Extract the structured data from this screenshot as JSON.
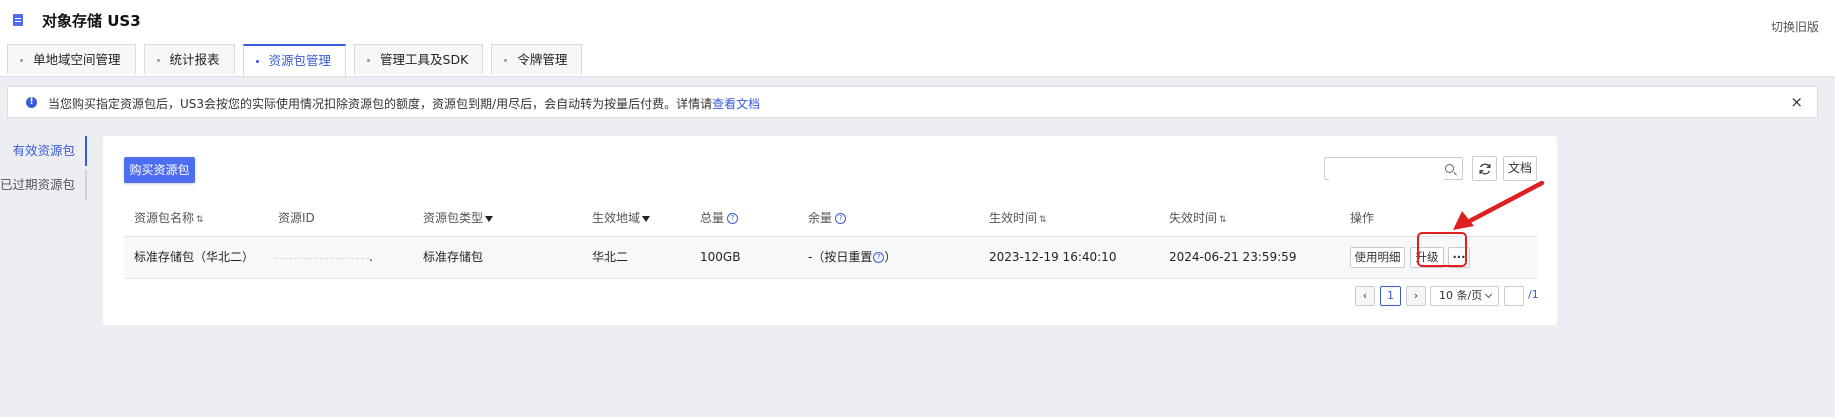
{
  "app": {
    "title": "对象存储 US3",
    "switch_label": "切换旧版"
  },
  "tabs": [
    {
      "label": "单地域空间管理",
      "active": false
    },
    {
      "label": "统计报表",
      "active": false
    },
    {
      "label": "资源包管理",
      "active": true
    },
    {
      "label": "管理工具及SDK",
      "active": false
    },
    {
      "label": "令牌管理",
      "active": false
    }
  ],
  "notice": {
    "text": "当您购买指定资源包后，US3会按您的实际使用情况扣除资源包的额度，资源包到期/用尽后，会自动转为按量后付费。详情请",
    "link": "查看文档",
    "close": "×"
  },
  "side": {
    "items": [
      {
        "label": "有效资源包",
        "active": true
      },
      {
        "label": "已过期资源包",
        "active": false
      }
    ]
  },
  "toolbar": {
    "buy_label": "购买资源包",
    "search_placeholder": "",
    "doc_label": "文档"
  },
  "table": {
    "headers": {
      "name": "资源包名称",
      "id": "资源ID",
      "type": "资源包类型",
      "region": "生效地域",
      "total": "总量",
      "remain": "余量",
      "start": "生效时间",
      "end": "失效时间",
      "ops": "操作"
    },
    "row": {
      "name": "标准存储包（华北二）",
      "id": ".",
      "type": "标准存储包",
      "region": "华北二",
      "total": "100GB",
      "remain": "-（按日重置",
      "remain_suffix": "）",
      "start": "2023-12-19 16:40:10",
      "end": "2024-06-21 23:59:59",
      "ops": {
        "detail": "使用明细",
        "upgrade": "升级",
        "more": "···"
      }
    }
  },
  "pager": {
    "prev": "‹",
    "page": "1",
    "next": "›",
    "size": "10 条/页",
    "jump": "",
    "total": "/1"
  },
  "colors": {
    "accent": "#3a5bd9",
    "button": "#4e6ef2",
    "highlight": "#e02020"
  }
}
